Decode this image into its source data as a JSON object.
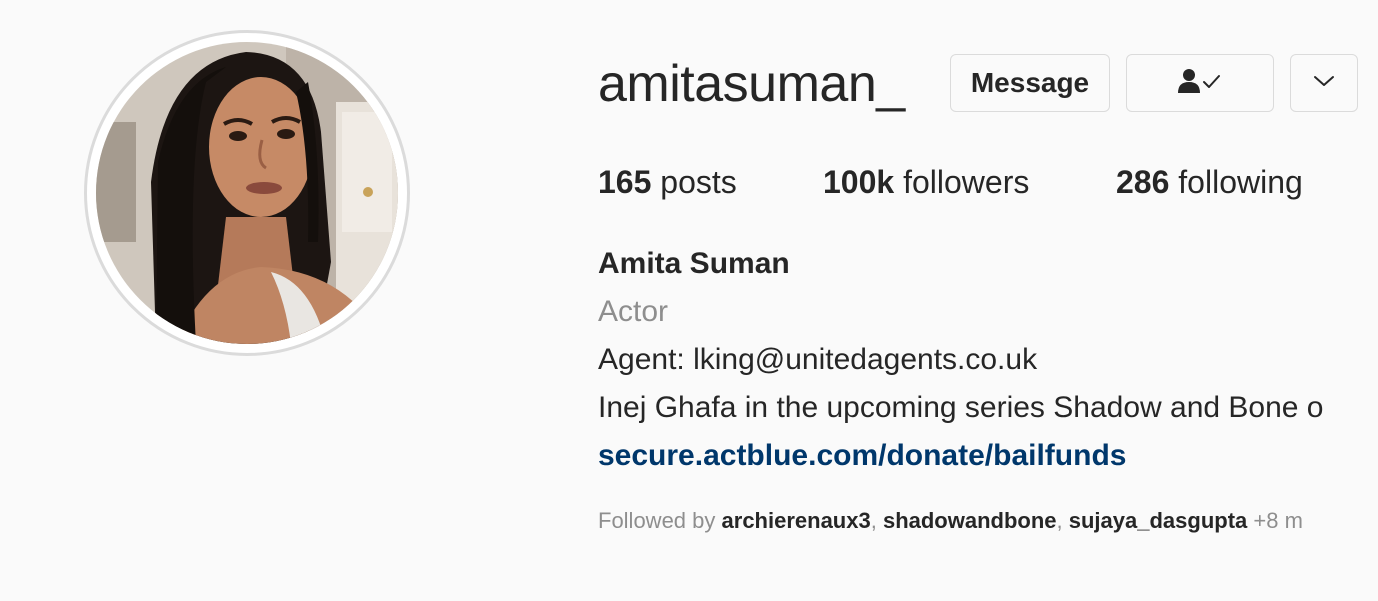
{
  "profile": {
    "username": "amitasuman_",
    "full_name": "Amita Suman",
    "category": "Actor",
    "bio_agent": "Agent: lking@unitedagents.co.uk",
    "bio_role": "Inej Ghafa in the upcoming series Shadow and Bone o",
    "link": "secure.actblue.com/donate/bailfunds"
  },
  "actions": {
    "message_label": "Message",
    "following_icon": "person-check-icon",
    "more_icon": "chevron-down-icon"
  },
  "stats": {
    "posts_count": "165",
    "posts_label": "posts",
    "followers_count": "100k",
    "followers_label": "followers",
    "following_count": "286",
    "following_label": "following"
  },
  "followed_by": {
    "prefix": "Followed by",
    "names": [
      "archierenaux3",
      "shadowandbone",
      "sujaya_dasgupta"
    ],
    "separator": ", ",
    "more": "+8 m"
  },
  "colors": {
    "background": "#fafafa",
    "text": "#262626",
    "secondary": "#8e8e8e",
    "link": "#00376b",
    "border": "#dbdbdb"
  }
}
